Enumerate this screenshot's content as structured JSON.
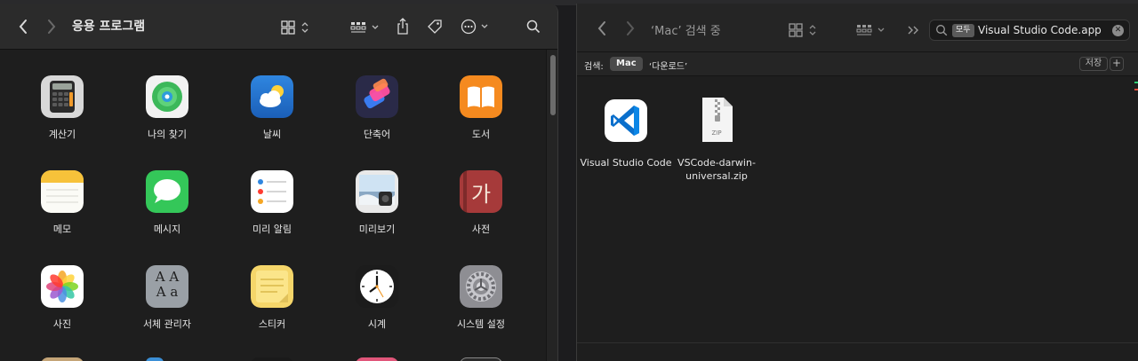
{
  "left_window": {
    "title": "응용 프로그램",
    "apps": [
      {
        "label": "계산기",
        "icon": "calculator-icon"
      },
      {
        "label": "나의 찾기",
        "icon": "find-my-icon"
      },
      {
        "label": "날씨",
        "icon": "weather-icon"
      },
      {
        "label": "단축어",
        "icon": "shortcuts-icon"
      },
      {
        "label": "도서",
        "icon": "books-icon"
      },
      {
        "label": "메모",
        "icon": "notes-icon"
      },
      {
        "label": "메시지",
        "icon": "messages-icon"
      },
      {
        "label": "미리 알림",
        "icon": "reminders-icon"
      },
      {
        "label": "미리보기",
        "icon": "preview-icon"
      },
      {
        "label": "사전",
        "icon": "dictionary-icon"
      },
      {
        "label": "사진",
        "icon": "photos-icon"
      },
      {
        "label": "서체 관리자",
        "icon": "font-book-icon"
      },
      {
        "label": "스티커",
        "icon": "stickies-icon"
      },
      {
        "label": "시계",
        "icon": "clock-icon"
      },
      {
        "label": "시스템 설정",
        "icon": "system-settings-icon"
      }
    ],
    "dictionary_glyph": "가",
    "fontbook_glyph": "A A\nA a"
  },
  "right_window": {
    "title": "‘Mac’ 검색 중",
    "search": {
      "token": "모두",
      "query": "Visual Studio Code.app",
      "clear": "✕"
    },
    "scope": {
      "label": "검색:",
      "selected": "Mac",
      "other": "‘다운로드’",
      "save": "저장",
      "add": "+"
    },
    "results": [
      {
        "label": "Visual Studio Code",
        "icon": "vscode-icon"
      },
      {
        "label": "VSCode-darwin-universal.zip",
        "icon": "zip-file-icon",
        "badge": "ZIP"
      }
    ]
  },
  "colors": {
    "window_bg": "#1e1e1e",
    "toolbar_bg": "#2b2b2b",
    "accent_vscode": "#0a6fcc"
  }
}
